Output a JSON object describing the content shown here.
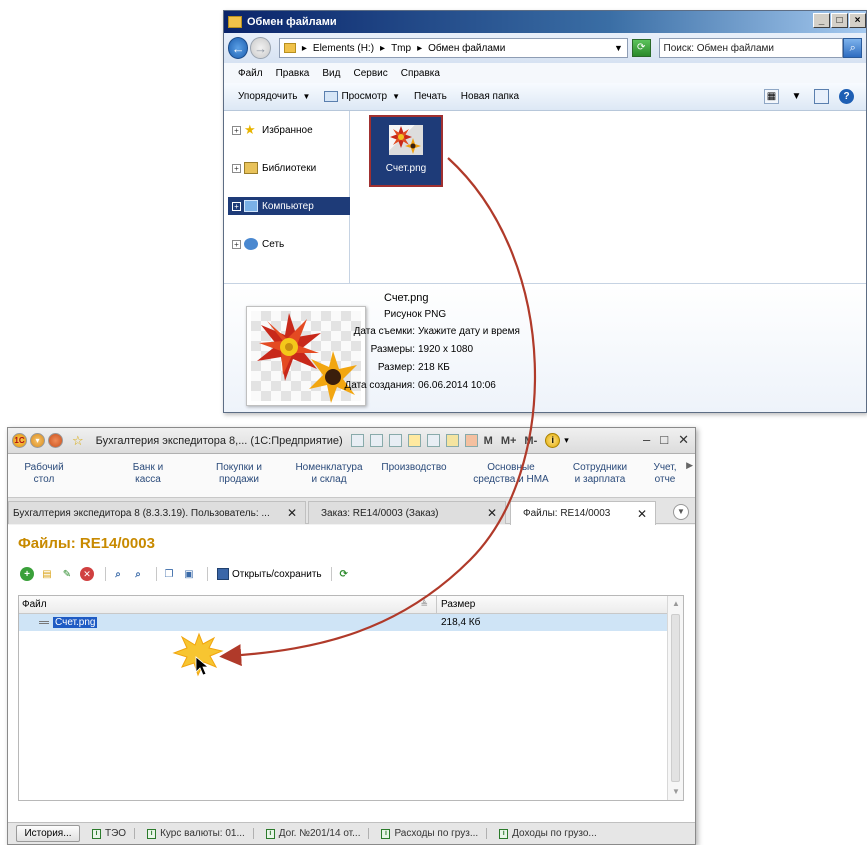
{
  "explorer": {
    "title": "Обмен файлами",
    "breadcrumbs": [
      "Elements (H:)",
      "Tmp",
      "Обмен файлами"
    ],
    "search_placeholder": "Поиск: Обмен файлами",
    "menu": [
      "Файл",
      "Правка",
      "Вид",
      "Сервис",
      "Справка"
    ],
    "toolbar": {
      "organize": "Упорядочить",
      "view": "Просмотр",
      "print": "Печать",
      "new_folder": "Новая папка"
    },
    "nav": [
      "Избранное",
      "Библиотеки",
      "Компьютер",
      "Сеть"
    ],
    "file": {
      "name": "Счет.png"
    },
    "details": {
      "name": "Счет.png",
      "type": "Рисунок PNG",
      "rows": [
        {
          "label": "Дата съемки:",
          "value": "Укажите дату и время"
        },
        {
          "label": "Размеры:",
          "value": "1920 x 1080"
        },
        {
          "label": "Размер:",
          "value": "218 КБ"
        },
        {
          "label": "Дата создания:",
          "value": "06.06.2014 10:06"
        }
      ]
    }
  },
  "onec": {
    "title": "Бухгалтерия экспедитора 8,... (1С:Предприятие)",
    "toolbar_text": [
      "M",
      "M+",
      "M-"
    ],
    "sections": [
      {
        "line1": "Рабочий",
        "line2": "стол"
      },
      {
        "line1": "Банк и",
        "line2": "касса"
      },
      {
        "line1": "Покупки и",
        "line2": "продажи"
      },
      {
        "line1": "Номенклатура",
        "line2": "и склад"
      },
      {
        "line1": "Производство",
        "line2": ""
      },
      {
        "line1": "Основные",
        "line2": "средства и НМА"
      },
      {
        "line1": "Сотрудники",
        "line2": "и зарплата"
      },
      {
        "line1": "Учет,",
        "line2": "отче"
      }
    ],
    "tabs": [
      {
        "label": "Бухгалтерия экспедитора 8 (8.3.3.19). Пользователь: ..."
      },
      {
        "label": "Заказ: RE14/0003 (Заказ)"
      },
      {
        "label": "Файлы: RE14/0003"
      }
    ],
    "form_title": "Файлы: RE14/0003",
    "open_save": "Открыть/сохранить",
    "grid": {
      "headers": [
        "Файл",
        "Размер"
      ],
      "rows": [
        {
          "file": "Счет.png",
          "size": "218,4 Кб"
        }
      ]
    },
    "status": {
      "history": "История...",
      "items": [
        "ТЭО",
        "Курс валюты: 01...",
        "Дог. №201/14 от...",
        "Расходы по груз...",
        "Доходы по грузо..."
      ]
    }
  }
}
